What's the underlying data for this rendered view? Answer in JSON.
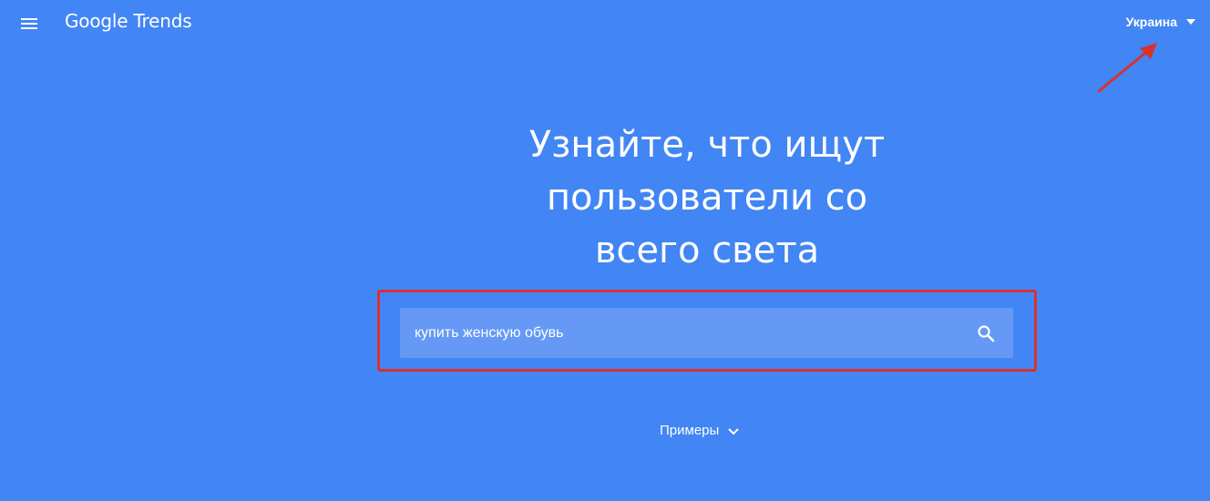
{
  "header": {
    "logo_text": "Google Trends",
    "menu_icon": "hamburger-menu-icon",
    "region": {
      "label": "Украина",
      "icon": "caret-down-icon"
    }
  },
  "hero": {
    "headline_line1": "Узнайте, что ищут",
    "headline_line2": "пользователи со",
    "headline_line3": "всего света"
  },
  "search": {
    "value": "купить женскую обувь",
    "placeholder": "",
    "icon": "search-icon"
  },
  "examples": {
    "label": "Примеры",
    "icon": "chevron-down-icon"
  },
  "colors": {
    "background": "#4285f4",
    "search_bg": "#6599f5",
    "annotation": "#d8322e",
    "text": "#ffffff"
  }
}
